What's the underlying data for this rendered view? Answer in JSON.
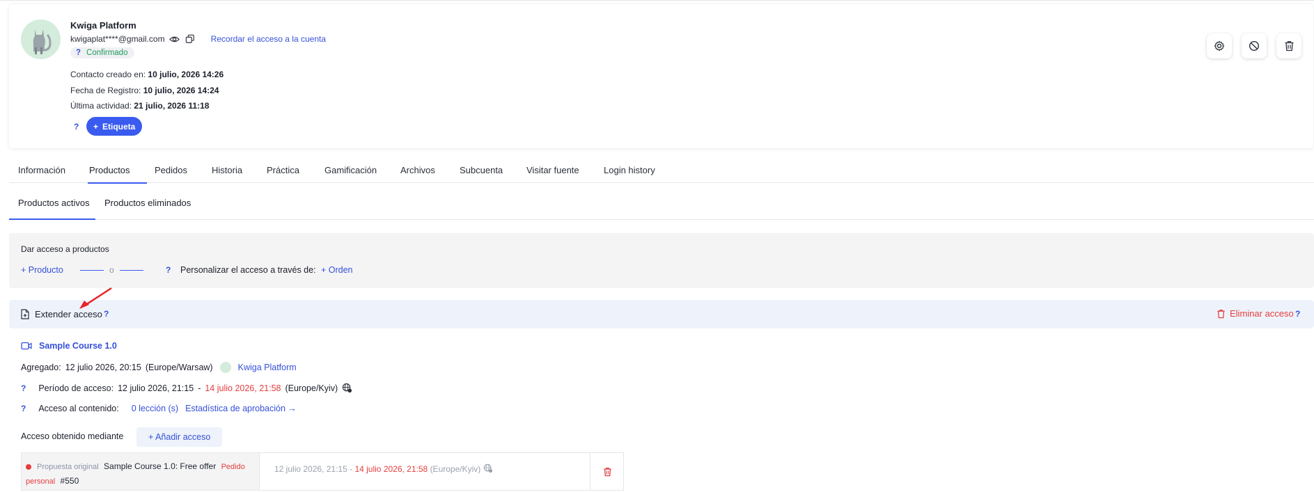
{
  "profile": {
    "name": "Kwiga Platform",
    "email": "kwigaplat****@gmail.com",
    "remind_link": "Recordar el acceso a la cuenta",
    "status_q": "?",
    "status": "Confirmado",
    "created_label": "Contacto creado en:",
    "created_value": "10 julio, 2026 14:26",
    "registered_label": "Fecha de Registro:",
    "registered_value": "10 julio, 2026 14:24",
    "last_activity_label": "Última actividad:",
    "last_activity_value": "21 julio, 2026 11:18",
    "tag_q": "?",
    "tag_button": "Etiqueta",
    "tag_plus": "+"
  },
  "actions": {
    "settings_icon": "gear-icon",
    "block_icon": "block-icon",
    "delete_icon": "trash-icon"
  },
  "tabs": [
    {
      "label": "Información"
    },
    {
      "label": "Productos"
    },
    {
      "label": "Pedidos"
    },
    {
      "label": "Historia"
    },
    {
      "label": "Práctica"
    },
    {
      "label": "Gamificación"
    },
    {
      "label": "Archivos"
    },
    {
      "label": "Subcuenta"
    },
    {
      "label": "Visitar fuente"
    },
    {
      "label": "Login history"
    }
  ],
  "active_tab": "Productos",
  "subtabs": [
    {
      "label": "Productos activos"
    },
    {
      "label": "Productos eliminados"
    }
  ],
  "grant": {
    "title": "Dar acceso a productos",
    "product_link": "+ Producto",
    "or": "o",
    "q": "?",
    "customize_label": "Personalizar el acceso a través de:",
    "order_link": "+ Orden"
  },
  "extend": {
    "label": "Extender acceso",
    "q": "?",
    "delete_label": "Eliminar acceso",
    "delete_q": "?"
  },
  "course": {
    "title": "Sample Course 1.0",
    "added_label": "Agregado:",
    "added_value": "12 julio 2026, 20:15",
    "added_tz": "(Europe/Warsaw)",
    "added_by": "Kwiga Platform",
    "period_q": "?",
    "period_label": "Período de acceso:",
    "period_start": "12 julio 2026, 21:15",
    "period_sep": "-",
    "period_end": "14 julio 2026, 21:58",
    "period_tz": "(Europe/Kyiv)",
    "content_q": "?",
    "content_label": "Acceso al contenido:",
    "lessons_link": "0 lección (s)",
    "stats_link": "Estadística de aprobación →",
    "obtained_label": "Acceso obtenido mediante",
    "add_access_button": "+ Añadir acceso"
  },
  "access_row": {
    "tag": "Propuesta original",
    "offer": "Sample Course 1.0: Free offer",
    "order_type": "Pedido personal",
    "order_number": "#550",
    "start": "12 julio 2026, 21:15",
    "sep": "-",
    "end": "14 julio 2026, 21:58",
    "tz": "(Europe/Kyiv)"
  },
  "colors": {
    "accent": "#3a5bf0",
    "link": "#3550d9",
    "danger": "#e53d3d",
    "success": "#1f9a5a"
  }
}
